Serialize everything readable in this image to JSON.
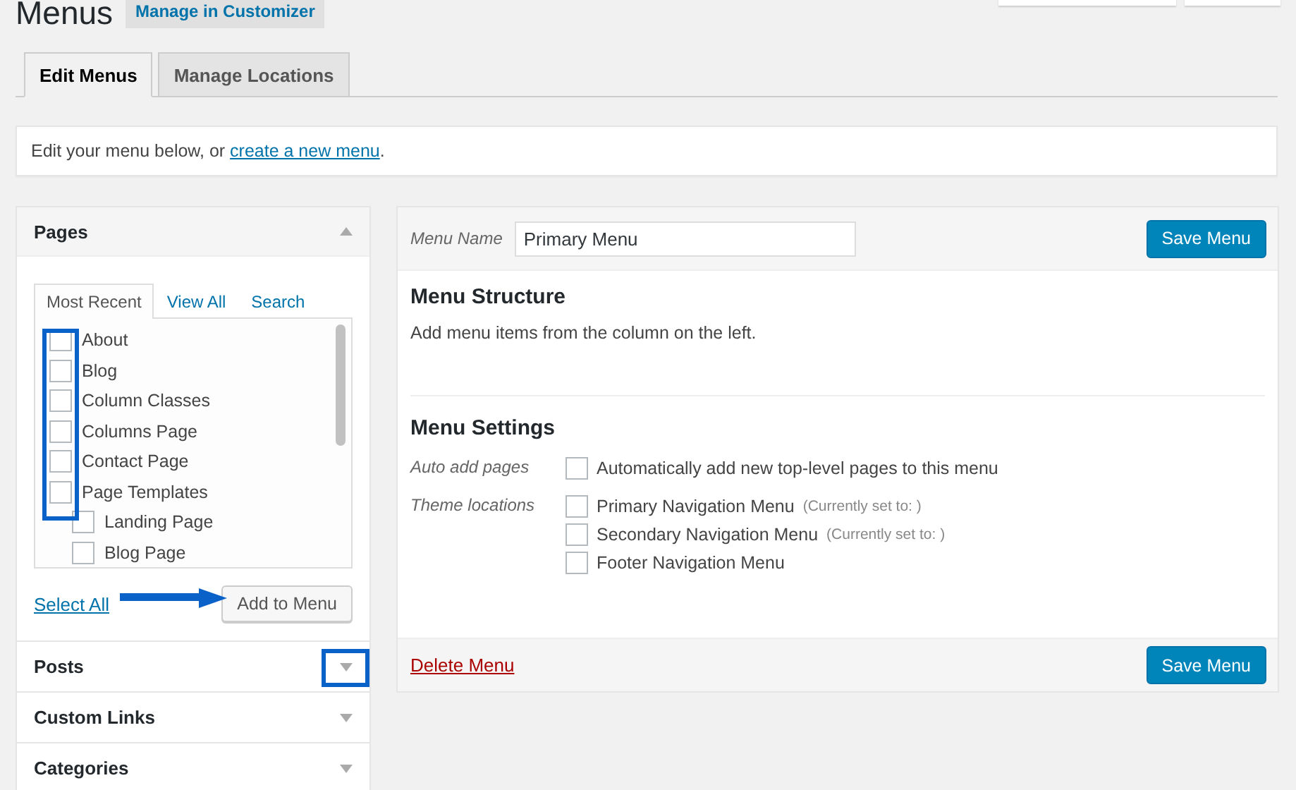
{
  "page": {
    "title": "Menus",
    "customizer_button": "Manage in Customizer"
  },
  "tabs": [
    {
      "label": "Edit Menus",
      "selected": true
    },
    {
      "label": "Manage Locations",
      "selected": false
    }
  ],
  "notice": {
    "text": "Edit your menu below, or ",
    "link": "create a new menu",
    "end": "."
  },
  "sidebar": {
    "sections": [
      {
        "title": "Pages",
        "expanded": true,
        "tabs": [
          {
            "label": "Most Recent",
            "selected": true
          },
          {
            "label": "View All",
            "selected": false
          },
          {
            "label": "Search",
            "selected": false
          }
        ],
        "items": [
          {
            "label": "About",
            "checked": false
          },
          {
            "label": "Blog",
            "checked": false
          },
          {
            "label": "Column Classes",
            "checked": false
          },
          {
            "label": "Columns Page",
            "checked": false
          },
          {
            "label": "Contact Page",
            "checked": false
          },
          {
            "label": "Page Templates",
            "checked": false,
            "children": [
              {
                "label": "Landing Page",
                "checked": false
              },
              {
                "label": "Blog Page",
                "checked": false
              }
            ]
          }
        ],
        "select_all": "Select All",
        "add_button": "Add to Menu"
      },
      {
        "title": "Posts",
        "expanded": false
      },
      {
        "title": "Custom Links",
        "expanded": false
      },
      {
        "title": "Categories",
        "expanded": false
      }
    ]
  },
  "editor": {
    "name_label": "Menu Name",
    "name_value": "Primary Menu",
    "save_button": "Save Menu",
    "structure_title": "Menu Structure",
    "structure_text": "Add menu items from the column on the left.",
    "settings_title": "Menu Settings",
    "auto_add": {
      "label": "Auto add pages",
      "options": [
        {
          "label": "Automatically add new top-level pages to this menu",
          "checked": false
        }
      ]
    },
    "locations": {
      "label": "Theme locations",
      "options": [
        {
          "label": "Primary Navigation Menu",
          "note": "(Currently set to: )",
          "checked": false
        },
        {
          "label": "Secondary Navigation Menu",
          "note": "(Currently set to: )",
          "checked": false
        },
        {
          "label": "Footer Navigation Menu",
          "checked": false
        }
      ]
    },
    "delete_link": "Delete Menu",
    "footer_save_button": "Save Menu"
  }
}
